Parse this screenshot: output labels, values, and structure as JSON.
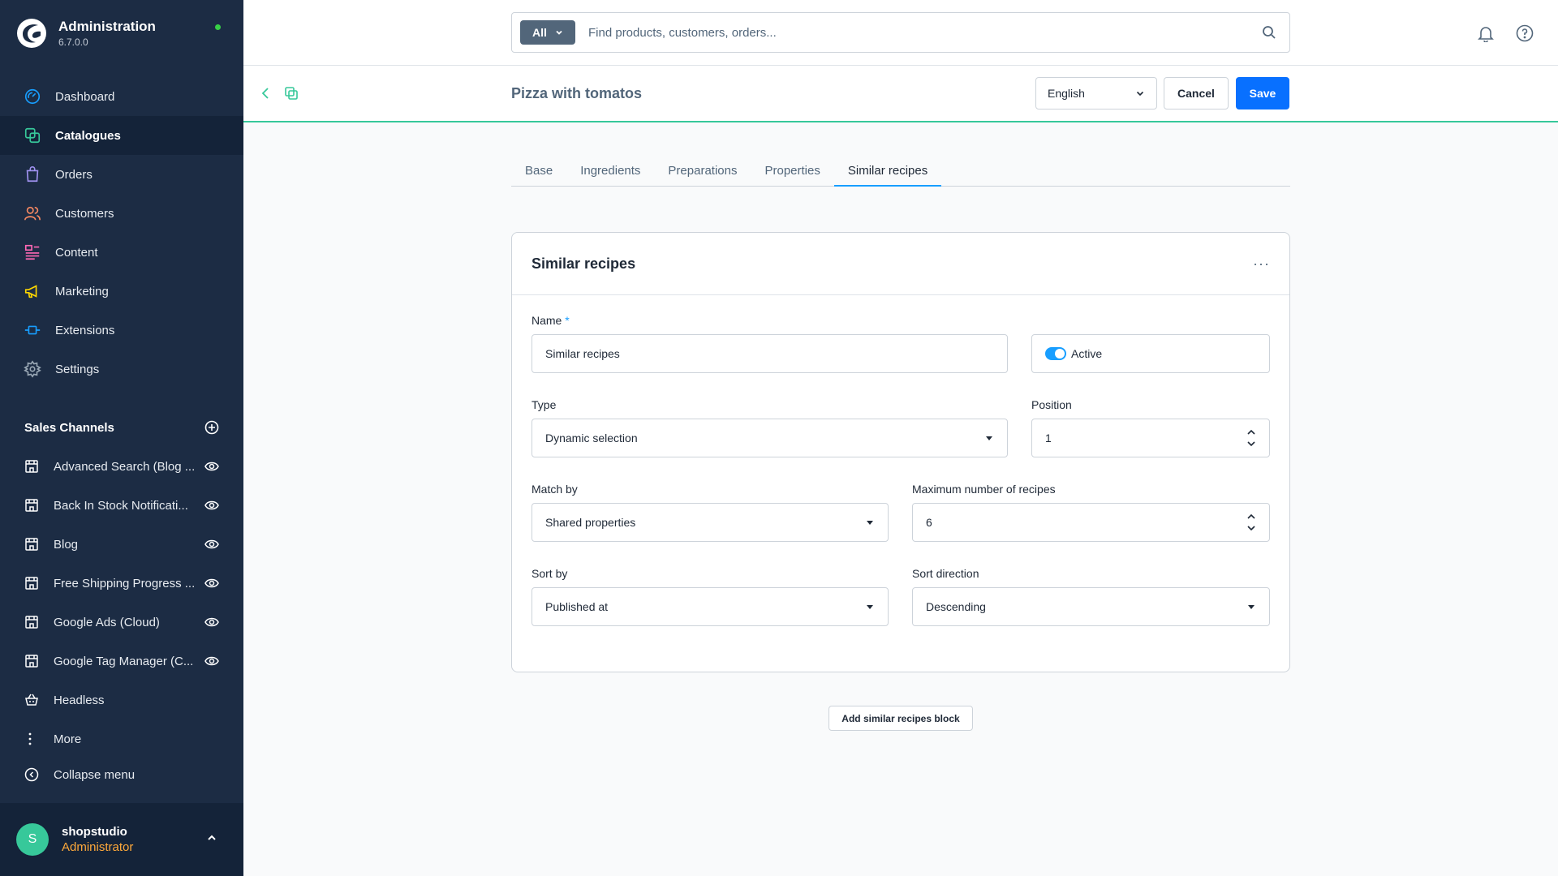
{
  "app": {
    "title": "Administration",
    "version": "6.7.0.0"
  },
  "nav": {
    "items": [
      {
        "label": "Dashboard",
        "icon": "dashboard-icon"
      },
      {
        "label": "Catalogues",
        "icon": "catalogues-icon",
        "active": true
      },
      {
        "label": "Orders",
        "icon": "orders-icon"
      },
      {
        "label": "Customers",
        "icon": "customers-icon"
      },
      {
        "label": "Content",
        "icon": "content-icon"
      },
      {
        "label": "Marketing",
        "icon": "marketing-icon"
      },
      {
        "label": "Extensions",
        "icon": "extensions-icon"
      },
      {
        "label": "Settings",
        "icon": "settings-icon"
      }
    ]
  },
  "sales_channels": {
    "title": "Sales Channels",
    "items": [
      {
        "label": "Advanced Search (Blog ..."
      },
      {
        "label": "Back In Stock Notificati..."
      },
      {
        "label": "Blog"
      },
      {
        "label": "Free Shipping Progress ..."
      },
      {
        "label": "Google Ads (Cloud)"
      },
      {
        "label": "Google Tag Manager (C..."
      },
      {
        "label": "Headless"
      }
    ],
    "more_label": "More",
    "collapse_label": "Collapse menu"
  },
  "user": {
    "initial": "S",
    "name": "shopstudio",
    "role": "Administrator"
  },
  "search": {
    "type_label": "All",
    "placeholder": "Find products, customers, orders..."
  },
  "smartbar": {
    "title": "Pizza with tomatos",
    "language": "English",
    "cancel_label": "Cancel",
    "save_label": "Save"
  },
  "tabs": [
    {
      "label": "Base"
    },
    {
      "label": "Ingredients"
    },
    {
      "label": "Preparations"
    },
    {
      "label": "Properties"
    },
    {
      "label": "Similar recipes",
      "active": true
    }
  ],
  "card": {
    "title": "Similar recipes",
    "menu": "···",
    "name_label": "Name",
    "name_required": "*",
    "name_value": "Similar recipes",
    "active_label": "Active",
    "active_on": true,
    "type_label": "Type",
    "type_value": "Dynamic selection",
    "position_label": "Position",
    "position_value": "1",
    "match_label": "Match by",
    "match_value": "Shared properties",
    "max_label": "Maximum number of recipes",
    "max_value": "6",
    "sort_label": "Sort by",
    "sort_value": "Published at",
    "dir_label": "Sort direction",
    "dir_value": "Descending"
  },
  "add_block_label": "Add similar recipes block",
  "colors": {
    "sidebar": "#1c2c44",
    "primary": "#0870ff",
    "accent": "#189eff",
    "success": "#37c89a",
    "role": "#ffa93a"
  }
}
